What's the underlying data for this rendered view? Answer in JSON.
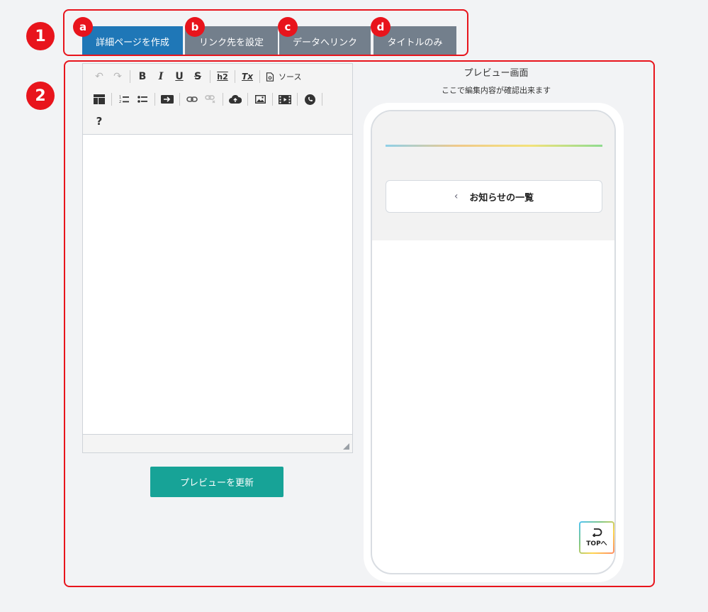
{
  "markers": {
    "one": "1",
    "two": "2",
    "a": "a",
    "b": "b",
    "c": "c",
    "d": "d"
  },
  "tabs": [
    {
      "label": "詳細ページを作成",
      "active": true
    },
    {
      "label": "リンク先を設定",
      "active": false
    },
    {
      "label": "データへリンク",
      "active": false
    },
    {
      "label": "タイトルのみ",
      "active": false
    }
  ],
  "toolbar": {
    "undo": "↶",
    "redo": "↷",
    "bold": "B",
    "italic": "I",
    "underline": "U",
    "strike": "S",
    "heading": "h2",
    "clear_format": "Tx",
    "source_label": "ソース",
    "help": "?"
  },
  "editor": {
    "content": ""
  },
  "preview_update_button": "プレビューを更新",
  "preview": {
    "title": "プレビュー画面",
    "subtitle": "ここで編集内容が確認出来ます",
    "notice_list_label": "お知らせの一覧",
    "top_button_label": "TOPへ"
  },
  "colors": {
    "red_marker": "#e8141c",
    "active_tab": "#1f77b7",
    "inactive_tab": "#737f8c",
    "preview_button": "#17a397"
  }
}
